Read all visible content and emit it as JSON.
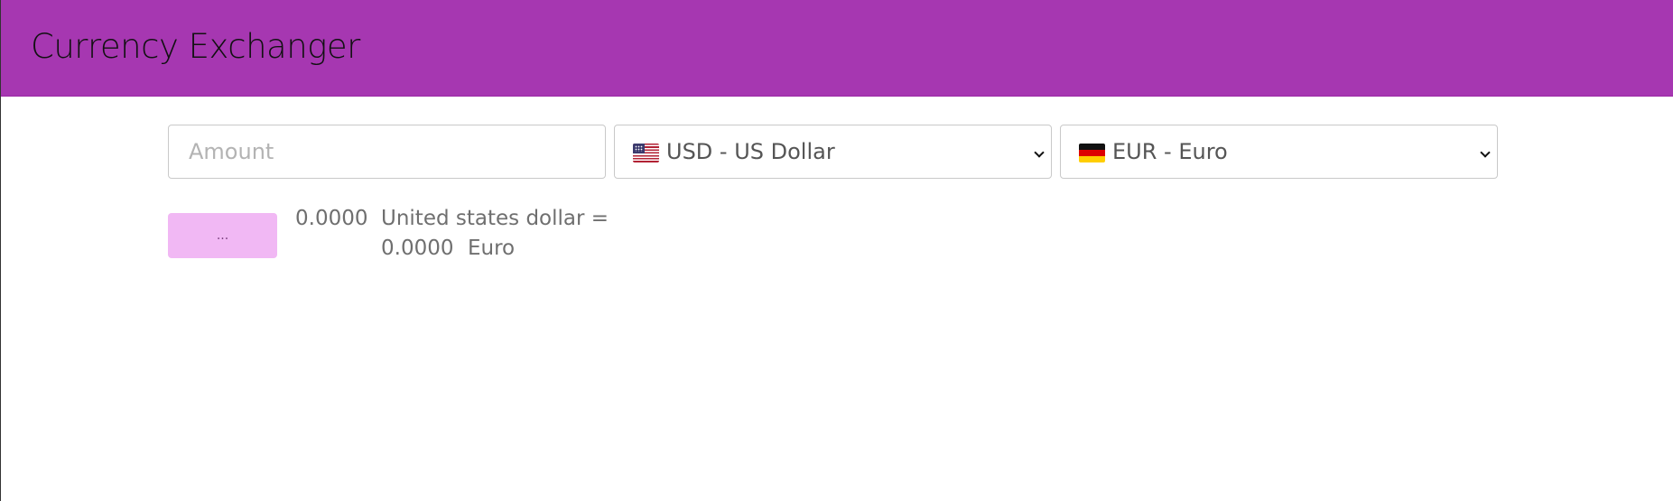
{
  "colors": {
    "header_bg": "#a637b1",
    "button_bg": "#f1b8f4",
    "text_muted": "#6f6f6f"
  },
  "header": {
    "title": "Currency Exchanger"
  },
  "form": {
    "amount": {
      "placeholder": "Amount",
      "value": ""
    },
    "from_currency": {
      "flag_icon": "us-flag-icon",
      "selected": "USD - US Dollar"
    },
    "to_currency": {
      "flag_icon": "de-flag-icon",
      "selected": "EUR - Euro"
    },
    "convert_button_label": "..."
  },
  "result": {
    "from_amount": "0.0000",
    "from_name": "United states dollar =",
    "to_amount": "0.0000",
    "to_name": "Euro"
  }
}
